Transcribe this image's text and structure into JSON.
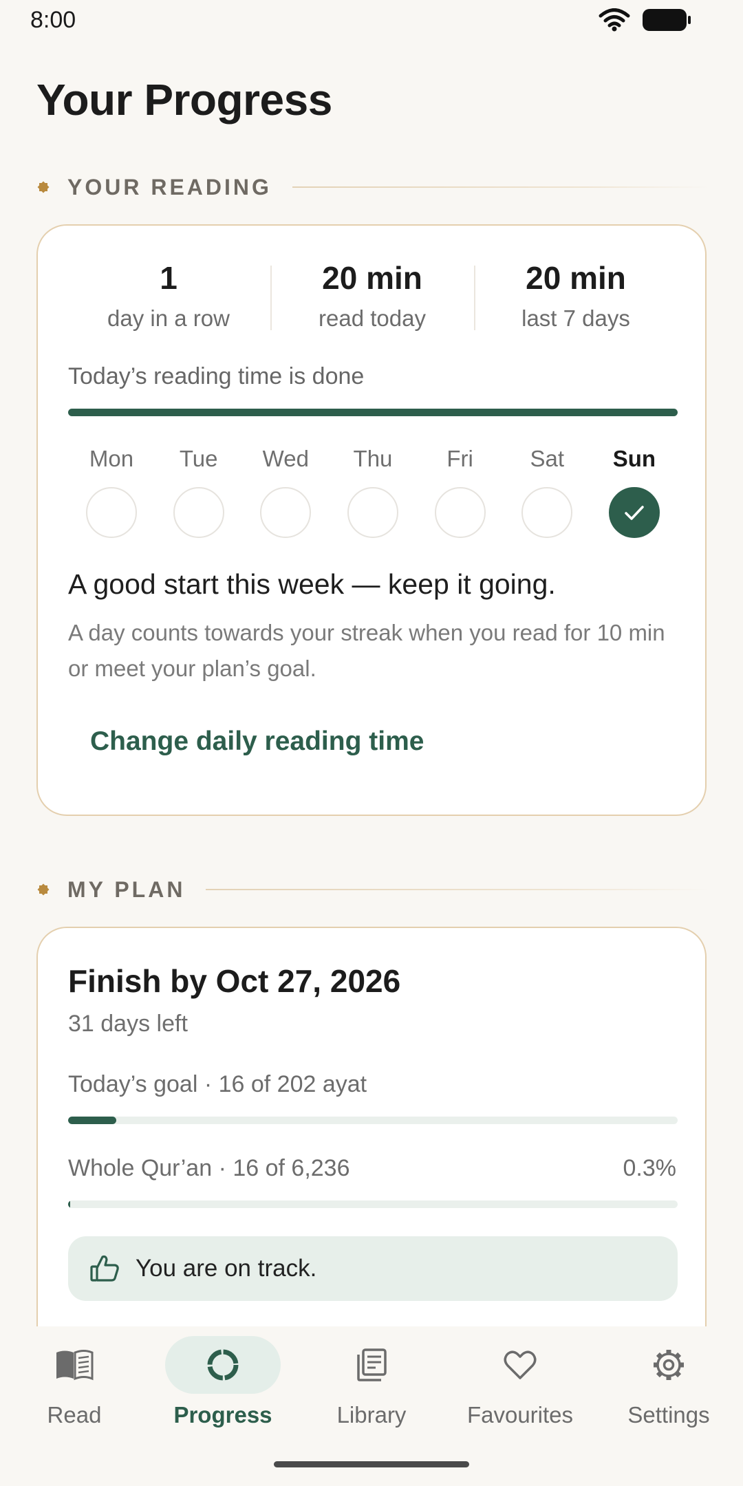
{
  "status_bar": {
    "time": "8:00"
  },
  "page": {
    "title": "Your Progress"
  },
  "reading": {
    "section_label": "YOUR READING",
    "stats": [
      {
        "value": "1",
        "label": "day in a row"
      },
      {
        "value": "20 min",
        "label": "read today"
      },
      {
        "value": "20 min",
        "label": "last 7 days"
      }
    ],
    "done_text": "Today’s reading time is done",
    "today_progress": 1.0,
    "days": [
      {
        "name": "Mon",
        "done": false
      },
      {
        "name": "Tue",
        "done": false
      },
      {
        "name": "Wed",
        "done": false
      },
      {
        "name": "Thu",
        "done": false
      },
      {
        "name": "Fri",
        "done": false
      },
      {
        "name": "Sat",
        "done": false
      },
      {
        "name": "Sun",
        "done": true
      }
    ],
    "message": "A good start this week — keep it going.",
    "note": "A day counts towards your streak when you read for 10 min or meet your plan’s goal.",
    "change_label": "Change daily reading time"
  },
  "plan": {
    "section_label": "MY PLAN",
    "title": "Finish by Oct 27, 2026",
    "days_left": "31 days left",
    "goal_text": "Today’s goal · 16 of 202 ayat",
    "goal_progress": 0.079,
    "quran_text": "Whole Qur’an · 16 of 6,236",
    "quran_pct": "0.3%",
    "quran_progress": 0.003,
    "track_text": "You are on track."
  },
  "nav": {
    "items": [
      {
        "label": "Read",
        "icon": "book-icon",
        "active": false
      },
      {
        "label": "Progress",
        "icon": "progress-ring-icon",
        "active": true
      },
      {
        "label": "Library",
        "icon": "library-icon",
        "active": false
      },
      {
        "label": "Favourites",
        "icon": "heart-icon",
        "active": false
      },
      {
        "label": "Settings",
        "icon": "gear-icon",
        "active": false
      }
    ]
  },
  "colors": {
    "accent": "#2d5e4c",
    "card_border": "#e4cfae",
    "background": "#f9f7f3",
    "star": "#b98a3e"
  }
}
